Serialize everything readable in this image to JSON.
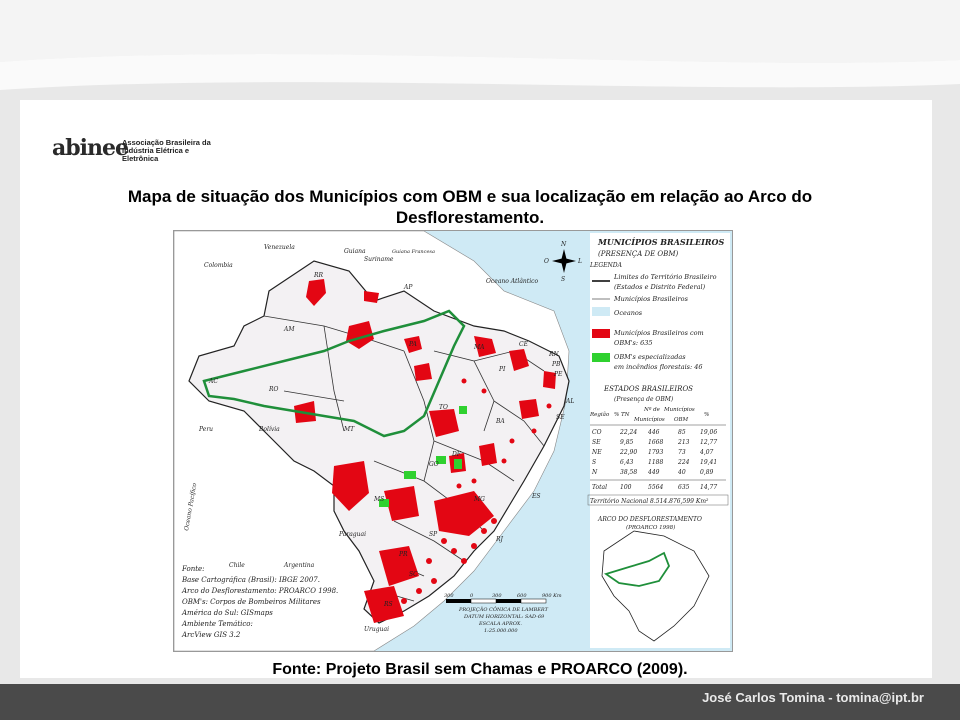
{
  "logo": {
    "mark": "abinee",
    "org_line1": "Associação Brasileira da",
    "org_line2": "Indústria Elétrica e Eletrônica"
  },
  "slide": {
    "title": "Mapa de situação dos Municípios com OBM e sua localização em relação ao Arco do Desflorestamento.",
    "caption": "Fonte: Projeto Brasil sem Chamas e PROARCO (2009).",
    "footer": "José Carlos Tomina - tomina@ipt.br"
  },
  "map": {
    "heading1": "MUNICÍPIOS BRASILEIROS",
    "heading2": "(PRESENÇA DE OBM)",
    "legend_label": "LEGENDA",
    "legend": [
      {
        "label": "Limites do Território Brasileiro",
        "label2": "(Estados e Distrito Federal)",
        "kind": "line",
        "color": "#000000"
      },
      {
        "label": "Municípios Brasileiros",
        "label2": "",
        "kind": "line",
        "color": "#aaaaaa"
      },
      {
        "label": "Oceanos",
        "label2": "",
        "kind": "box",
        "color": "#cfeaf5"
      },
      {
        "label": "Municípios Brasileiros com",
        "label2": "OBM's: 635",
        "kind": "box",
        "color": "#e30613"
      },
      {
        "label": "OBM's especializadas",
        "label2": "em incêndios florestais: 46",
        "kind": "box",
        "color": "#2fd12f"
      }
    ],
    "states_title1": "ESTADOS BRASILEIROS",
    "states_title2": "(Presença de OBM)",
    "table_headers": [
      "Região",
      "% TN",
      "Nº de",
      "Municípios",
      "Municípios",
      "OBM",
      "%"
    ],
    "table_rows": [
      [
        "CO",
        "22,24",
        "446",
        "85",
        "19,06"
      ],
      [
        "SE",
        "9,85",
        "1668",
        "213",
        "12,77"
      ],
      [
        "NE",
        "22,90",
        "1793",
        "73",
        "4,07"
      ],
      [
        "S",
        "6,43",
        "1188",
        "224",
        "19,41"
      ],
      [
        "N",
        "38,58",
        "449",
        "40",
        "0,89"
      ]
    ],
    "total_row": [
      "Total",
      "100",
      "5564",
      "635",
      "14,77"
    ],
    "territory": "Território Nacional  8.514.876,599 Km²",
    "arco_title1": "ARCO DO DESFLORESTAMENTO",
    "arco_title2": "(PROARCO 1998)",
    "ocean_label": "Oceano Atlântico",
    "ocean_label2": "Oceano Pacífico",
    "countries": [
      "Venezuela",
      "Guiana",
      "Suriname",
      "Guiana Francesa",
      "Colombia",
      "Peru",
      "Bolívia",
      "Paraguai",
      "Argentina",
      "Chile",
      "Uruguai"
    ],
    "states": [
      "RR",
      "AP",
      "AM",
      "PA",
      "MA",
      "CE",
      "RN",
      "PB",
      "PE",
      "AL",
      "SE",
      "BA",
      "PI",
      "TO",
      "AC",
      "RO",
      "MT",
      "GO",
      "DF",
      "MG",
      "ES",
      "RJ",
      "SP",
      "MS",
      "PR",
      "SC",
      "RS"
    ],
    "compass": [
      "N",
      "S",
      "L",
      "O"
    ],
    "scale_ticks": [
      "300",
      "0",
      "300",
      "600",
      "900 Km"
    ],
    "projection": [
      "PROJEÇÃO CÔNICA DE LAMBERT",
      "DATUM HORIZONTAL: SAD-69",
      "ESCALA APROX.",
      "1:25.000.000"
    ],
    "source": [
      "Fonte:",
      "Base Cartográfica (Brasil): IBGE 2007.",
      "Arco do Desflorestamento: PROARCO 1998.",
      "OBM's: Corpos de Bombeiros Militares",
      "América do Sul: GISmaps",
      "Ambiente Temático:",
      "ArcView GIS 3.2"
    ],
    "colors": {
      "obm": "#e30613",
      "forest": "#2fd12f",
      "arc": "#1f8f3a",
      "ocean": "#cfeaf5"
    }
  }
}
